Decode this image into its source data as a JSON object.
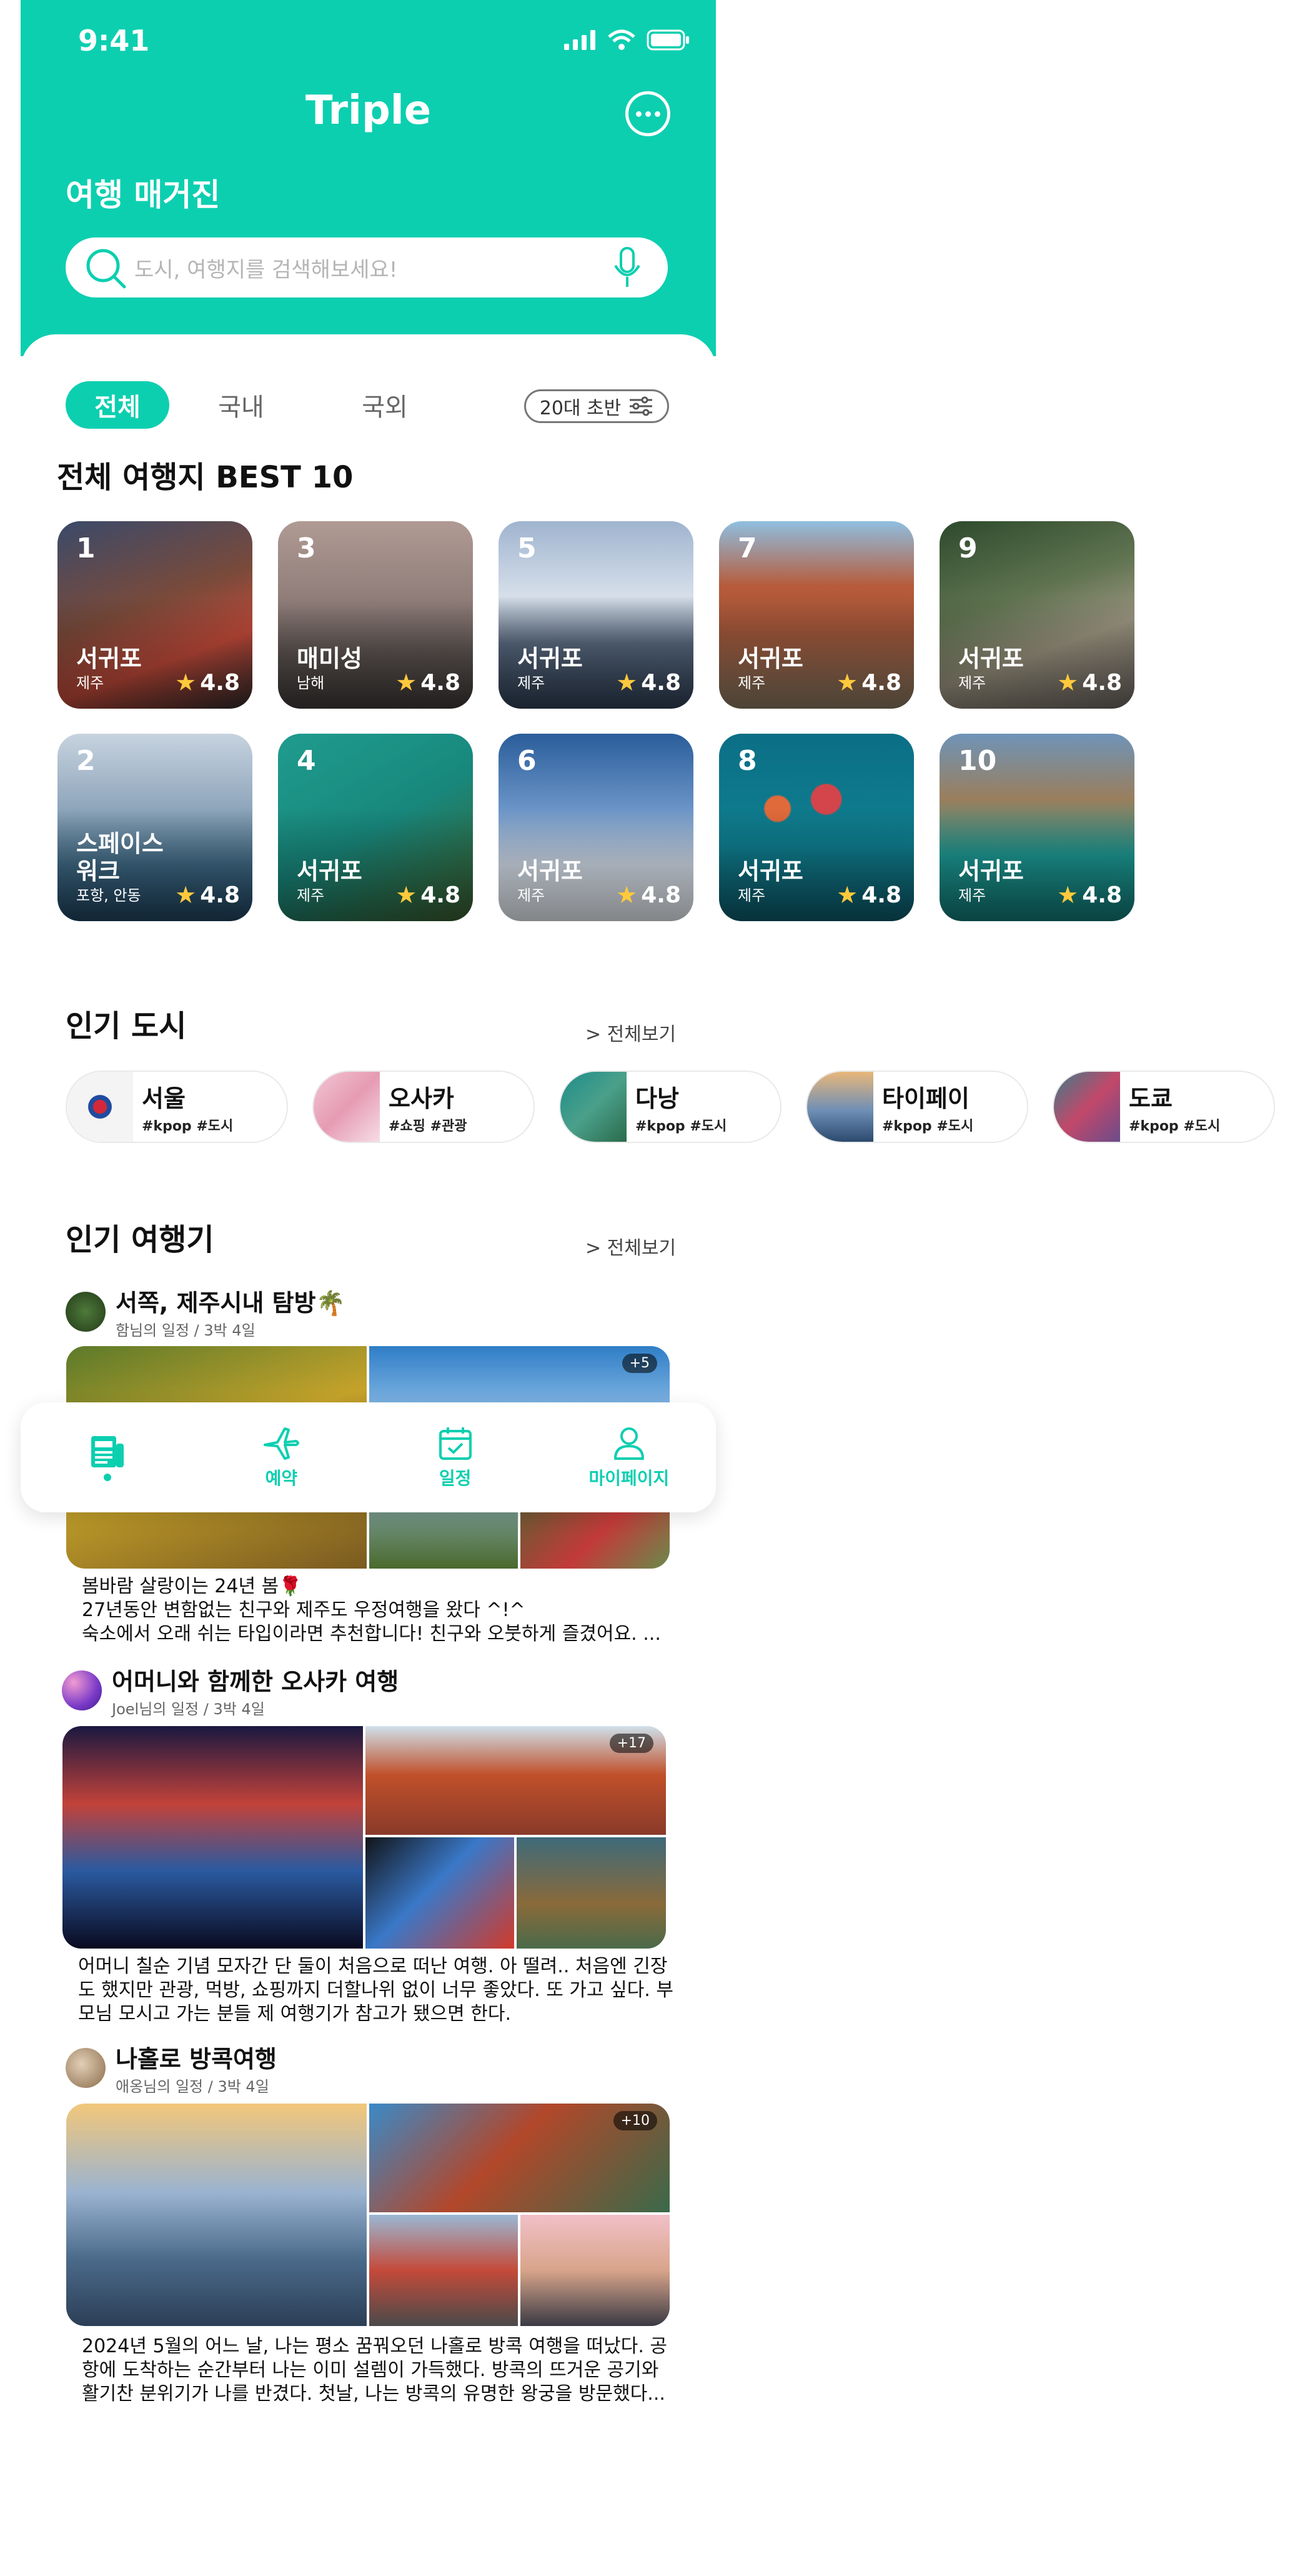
{
  "status_bar": {
    "time": "9:41"
  },
  "header": {
    "title": "Triple",
    "magazine_label": "여행 매거진"
  },
  "search": {
    "placeholder": "도시, 여행지를 검색해보세요!"
  },
  "tabs": [
    {
      "label": "전체",
      "active": true
    },
    {
      "label": "국내",
      "active": false
    },
    {
      "label": "국외",
      "active": false
    }
  ],
  "filter": {
    "label": "20대 초반"
  },
  "best": {
    "title": "전체 여행지 BEST 10",
    "items": [
      {
        "rank": "1",
        "name": "서귀포",
        "region": "제주",
        "rating": "4.8"
      },
      {
        "rank": "3",
        "name": "매미성",
        "region": "남해",
        "rating": "4.8"
      },
      {
        "rank": "5",
        "name": "서귀포",
        "region": "제주",
        "rating": "4.8"
      },
      {
        "rank": "7",
        "name": "서귀포",
        "region": "제주",
        "rating": "4.8"
      },
      {
        "rank": "9",
        "name": "서귀포",
        "region": "제주",
        "rating": "4.8"
      },
      {
        "rank": "2",
        "name": "스페이스\n워크",
        "region": "포항, 안동",
        "rating": "4.8"
      },
      {
        "rank": "4",
        "name": "서귀포",
        "region": "제주",
        "rating": "4.8"
      },
      {
        "rank": "6",
        "name": "서귀포",
        "region": "제주",
        "rating": "4.8"
      },
      {
        "rank": "8",
        "name": "서귀포",
        "region": "제주",
        "rating": "4.8"
      },
      {
        "rank": "10",
        "name": "서귀포",
        "region": "제주",
        "rating": "4.8"
      }
    ]
  },
  "cities": {
    "title": "인기 도시",
    "more": "> 전체보기",
    "items": [
      {
        "name": "서울",
        "tags": "#kpop #도시"
      },
      {
        "name": "오사카",
        "tags": "#쇼핑 #관광"
      },
      {
        "name": "다낭",
        "tags": "#kpop #도시"
      },
      {
        "name": "타이페이",
        "tags": "#kpop #도시"
      },
      {
        "name": "도쿄",
        "tags": "#kpop #도시"
      }
    ]
  },
  "travelogues": {
    "title": "인기 여행기",
    "more": "> 전체보기",
    "posts": [
      {
        "title": "서쪽, 제주시내 탐방🌴",
        "sub": "함님의 일정 / 3박 4일",
        "extra": "+5",
        "text": [
          "봄바람 살랑이는 24년 봄🌹",
          "27년동안 변함없는 친구와 제주도 우정여행을 왔다 ^!^",
          "숙소에서 오래 쉬는 타입이라면 추천합니다! 친구와 오붓하게 즐겼어요. ..."
        ]
      },
      {
        "title": "어머니와 함께한 오사카 여행",
        "sub": "Joel님의 일정 / 3박 4일",
        "extra": "+17",
        "text": [
          "어머니 칠순 기념 모자간 단 둘이 처음으로 떠난 여행. 아 떨려.. 처음엔 긴장",
          "도 했지만 관광, 먹방, 쇼핑까지 더할나위 없이 너무 좋았다. 또 가고 싶다. 부",
          "모님 모시고 가는 분들 제 여행기가 참고가 됐으면 한다."
        ]
      },
      {
        "title": "나홀로 방콕여행",
        "sub": "애옹님의 일정 / 3박 4일",
        "extra": "+10",
        "text": [
          "2024년 5월의 어느 날, 나는 평소 꿈꿔오던 나홀로 방콕 여행을 떠났다. 공",
          "항에 도착하는 순간부터 나는 이미 설렘이 가득했다. 방콕의 뜨거운 공기와",
          "활기찬 분위기가 나를 반겼다. 첫날, 나는 방콕의 유명한 왕궁을 방문했다..."
        ]
      }
    ]
  },
  "bottom_nav": [
    {
      "icon": "magazine-icon",
      "label": "",
      "active": true
    },
    {
      "icon": "airplane-icon",
      "label": "예약"
    },
    {
      "icon": "calendar-icon",
      "label": "일정"
    },
    {
      "icon": "person-icon",
      "label": "마이페이지"
    }
  ],
  "colors": {
    "accent": "#0ccfb0"
  }
}
